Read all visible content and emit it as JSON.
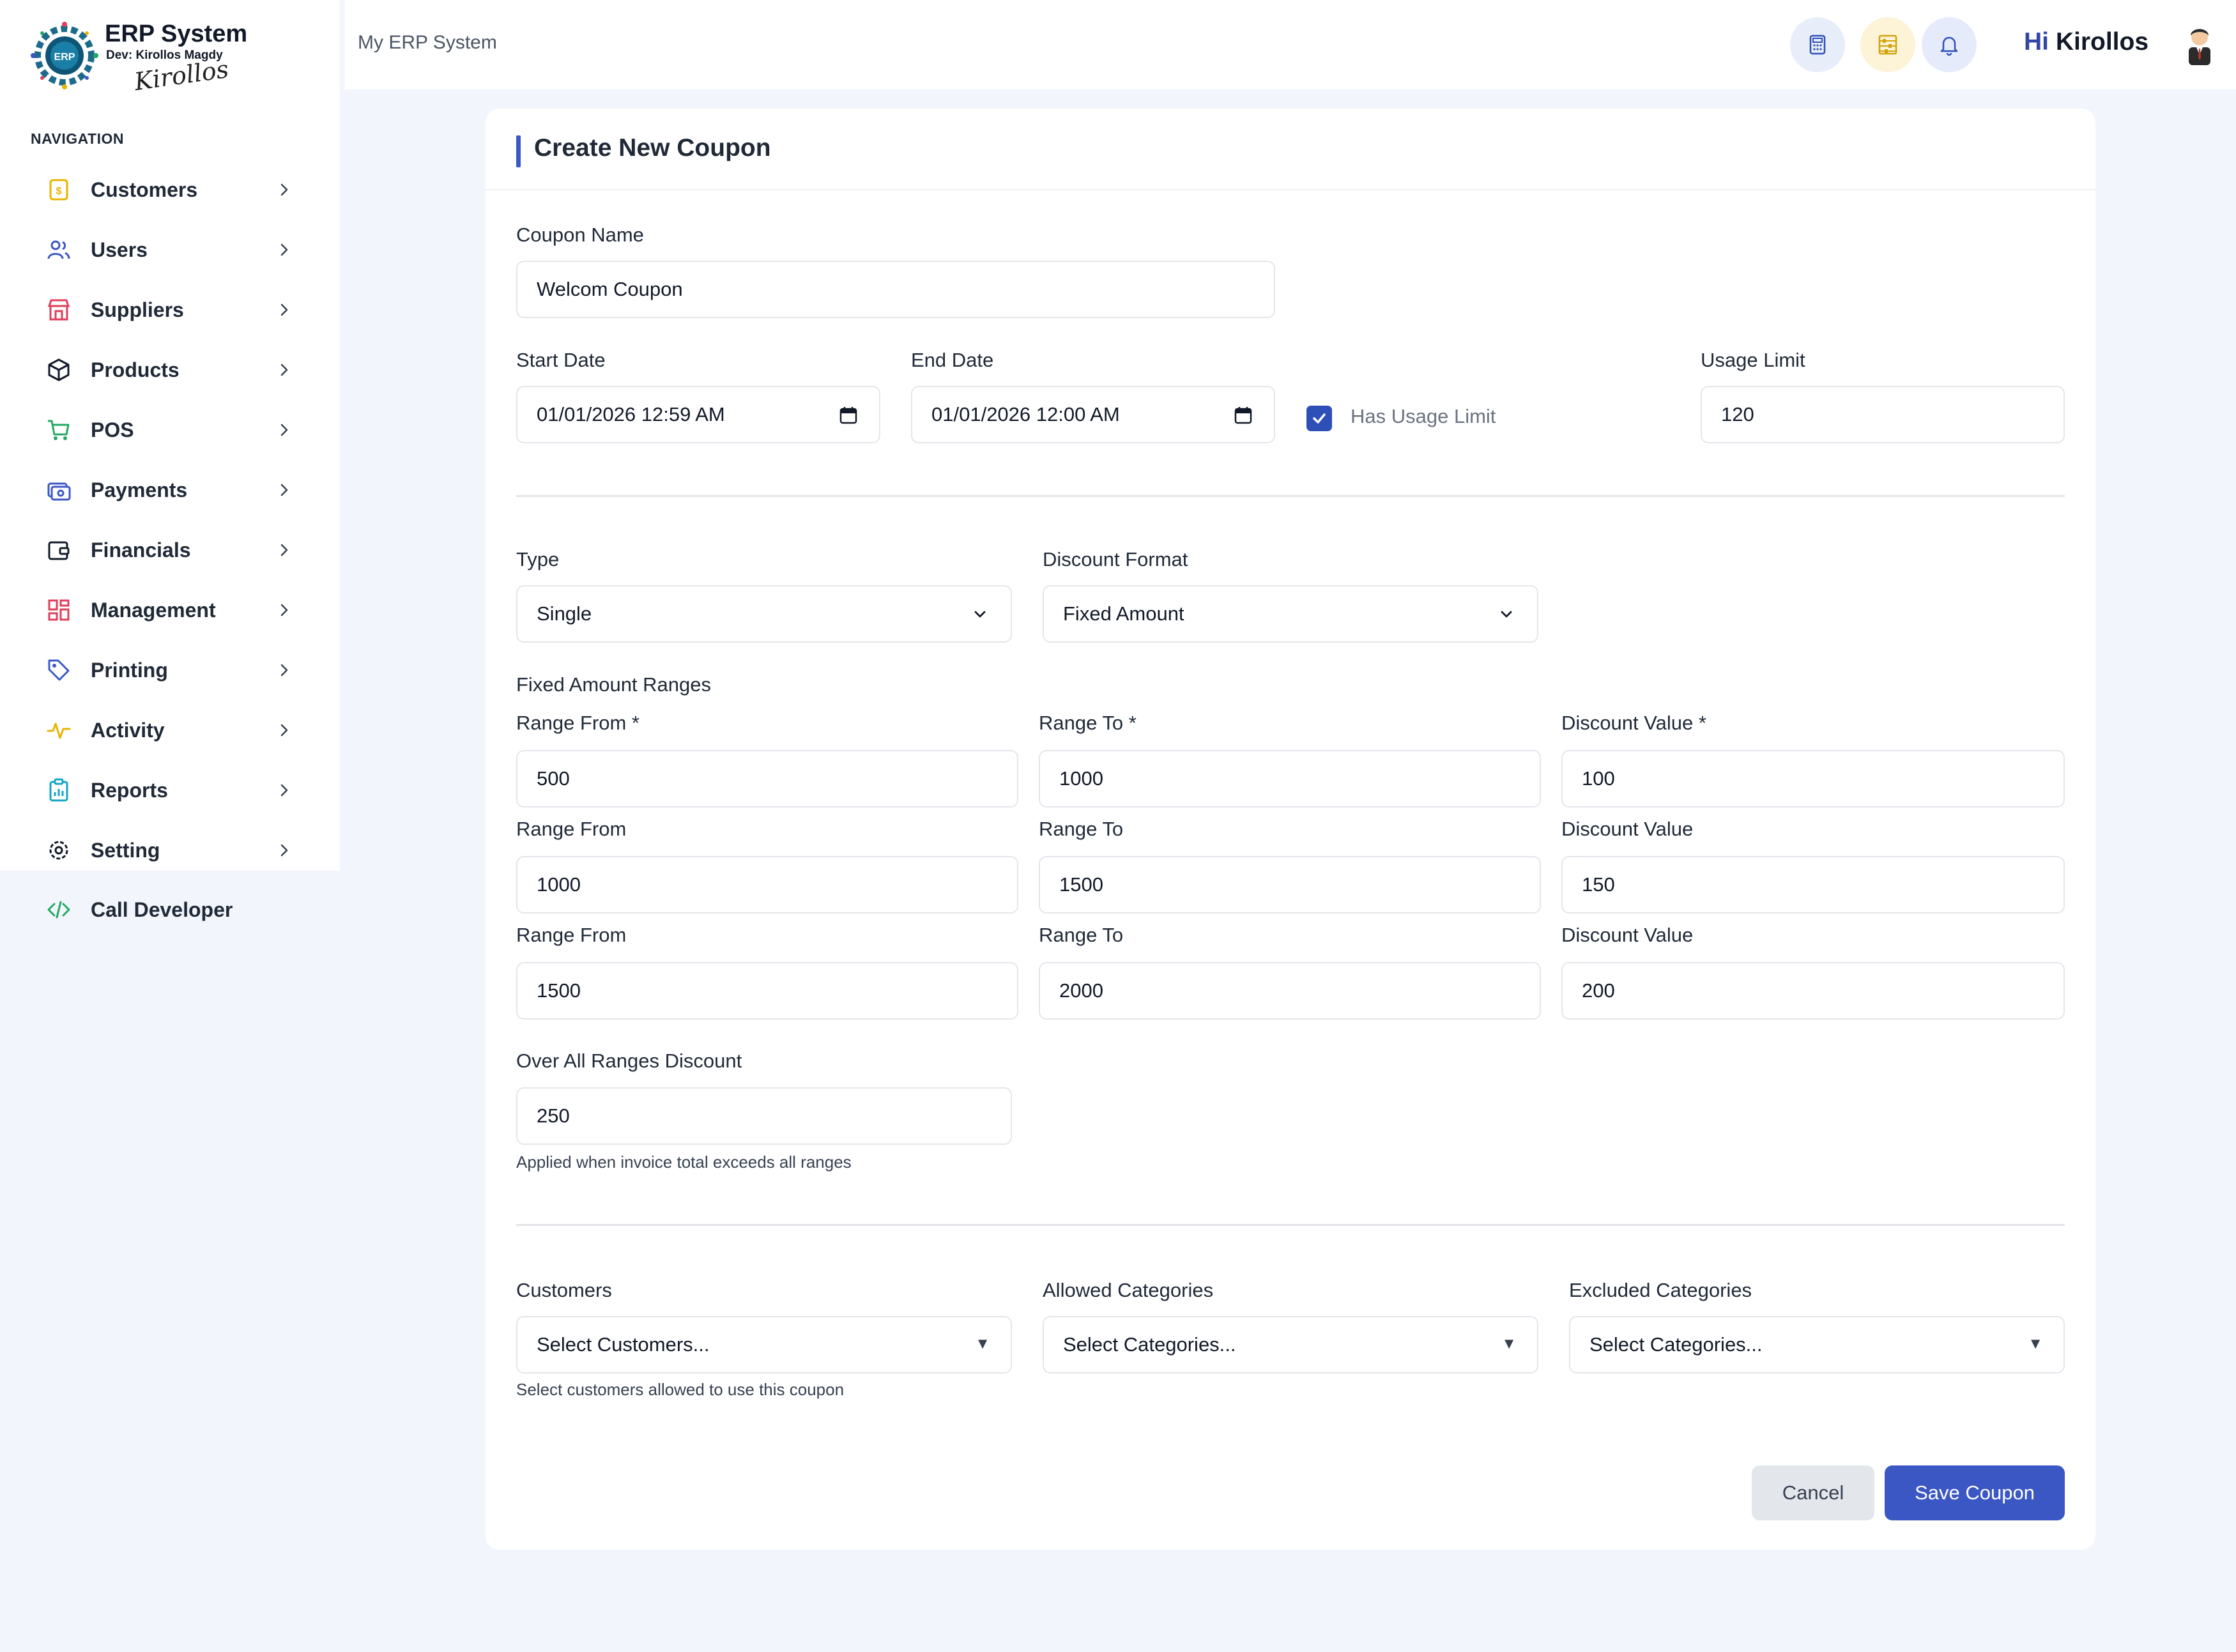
{
  "brand": {
    "title": "ERP System",
    "dev": "Dev: Kirollos Magdy",
    "signature": "Kirollos",
    "gear_text": "ERP"
  },
  "nav": {
    "heading": "NAVIGATION",
    "items": [
      {
        "label": "Customers",
        "icon": "customers-icon",
        "color": "#e8b400"
      },
      {
        "label": "Users",
        "icon": "users-icon",
        "color": "#3b57c4"
      },
      {
        "label": "Suppliers",
        "icon": "store-icon",
        "color": "#e03e5a"
      },
      {
        "label": "Products",
        "icon": "box-icon",
        "color": "#111827"
      },
      {
        "label": "POS",
        "icon": "cart-icon",
        "color": "#22a861"
      },
      {
        "label": "Payments",
        "icon": "payments-icon",
        "color": "#3b57c4"
      },
      {
        "label": "Financials",
        "icon": "wallet-icon",
        "color": "#111827"
      },
      {
        "label": "Management",
        "icon": "grid-icon",
        "color": "#e03e5a"
      },
      {
        "label": "Printing",
        "icon": "tag-icon",
        "color": "#3b57c4"
      },
      {
        "label": "Activity",
        "icon": "activity-icon",
        "color": "#e8b400"
      },
      {
        "label": "Reports",
        "icon": "clipboard-icon",
        "color": "#14a5c4"
      },
      {
        "label": "Setting",
        "icon": "gear-icon",
        "color": "#111827"
      }
    ],
    "call_developer": "Call Developer"
  },
  "topbar": {
    "breadcrumb": "My ERP System",
    "greeting_hi": "Hi",
    "greeting_name": "Kirollos"
  },
  "form": {
    "title": "Create New Coupon",
    "coupon_name": {
      "label": "Coupon Name",
      "value": "Welcom Coupon"
    },
    "start_date": {
      "label": "Start Date",
      "value": "01/01/2026 12:59  AM"
    },
    "end_date": {
      "label": "End Date",
      "value": "01/01/2026 12:00  AM"
    },
    "has_usage_limit": {
      "label": "Has Usage Limit",
      "checked": true
    },
    "usage_limit": {
      "label": "Usage Limit",
      "value": "120"
    },
    "type": {
      "label": "Type",
      "value": "Single"
    },
    "discount_format": {
      "label": "Discount Format",
      "value": "Fixed Amount"
    },
    "ranges_heading": "Fixed Amount Ranges",
    "ranges": [
      {
        "from_label": "Range From *",
        "to_label": "Range To *",
        "value_label": "Discount Value *",
        "from": "500",
        "to": "1000",
        "discount": "100"
      },
      {
        "from_label": "Range From",
        "to_label": "Range To",
        "value_label": "Discount Value",
        "from": "1000",
        "to": "1500",
        "discount": "150"
      },
      {
        "from_label": "Range From",
        "to_label": "Range To",
        "value_label": "Discount Value",
        "from": "1500",
        "to": "2000",
        "discount": "200"
      }
    ],
    "over_all": {
      "label": "Over All Ranges Discount",
      "value": "250",
      "hint": "Applied when invoice total exceeds all ranges"
    },
    "customers": {
      "label": "Customers",
      "placeholder": "Select Customers...",
      "hint": "Select customers allowed to use this coupon"
    },
    "allowed_categories": {
      "label": "Allowed Categories",
      "placeholder": "Select Categories..."
    },
    "excluded_categories": {
      "label": "Excluded Categories",
      "placeholder": "Select Categories..."
    },
    "cancel_label": "Cancel",
    "save_label": "Save Coupon"
  },
  "colors": {
    "accent": "#3b57c4",
    "background": "#f2f6fc"
  }
}
